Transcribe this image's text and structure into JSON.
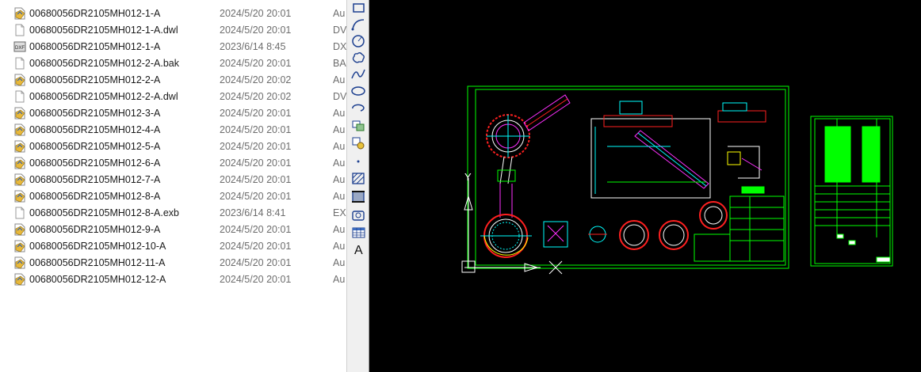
{
  "files": [
    {
      "name": "00680056DR2105MH012-1-A",
      "date": "2024/5/20 20:01",
      "type": "Au",
      "icon": "dwg-icon"
    },
    {
      "name": "00680056DR2105MH012-1-A.dwl",
      "date": "2024/5/20 20:01",
      "type": "DV",
      "icon": "blank-file-icon"
    },
    {
      "name": "00680056DR2105MH012-1-A",
      "date": "2023/6/14 8:45",
      "type": "DX",
      "icon": "dxf-icon"
    },
    {
      "name": "00680056DR2105MH012-2-A.bak",
      "date": "2024/5/20 20:01",
      "type": "BA",
      "icon": "blank-file-icon"
    },
    {
      "name": "00680056DR2105MH012-2-A",
      "date": "2024/5/20 20:02",
      "type": "Au",
      "icon": "dwg-icon"
    },
    {
      "name": "00680056DR2105MH012-2-A.dwl",
      "date": "2024/5/20 20:02",
      "type": "DV",
      "icon": "blank-file-icon"
    },
    {
      "name": "00680056DR2105MH012-3-A",
      "date": "2024/5/20 20:01",
      "type": "Au",
      "icon": "dwg-icon"
    },
    {
      "name": "00680056DR2105MH012-4-A",
      "date": "2024/5/20 20:01",
      "type": "Au",
      "icon": "dwg-icon"
    },
    {
      "name": "00680056DR2105MH012-5-A",
      "date": "2024/5/20 20:01",
      "type": "Au",
      "icon": "dwg-icon"
    },
    {
      "name": "00680056DR2105MH012-6-A",
      "date": "2024/5/20 20:01",
      "type": "Au",
      "icon": "dwg-icon"
    },
    {
      "name": "00680056DR2105MH012-7-A",
      "date": "2024/5/20 20:01",
      "type": "Au",
      "icon": "dwg-icon"
    },
    {
      "name": "00680056DR2105MH012-8-A",
      "date": "2024/5/20 20:01",
      "type": "Au",
      "icon": "dwg-icon"
    },
    {
      "name": "00680056DR2105MH012-8-A.exb",
      "date": "2023/6/14 8:41",
      "type": "EX",
      "icon": "blank-file-icon"
    },
    {
      "name": "00680056DR2105MH012-9-A",
      "date": "2024/5/20 20:01",
      "type": "Au",
      "icon": "dwg-icon"
    },
    {
      "name": "00680056DR2105MH012-10-A",
      "date": "2024/5/20 20:01",
      "type": "Au",
      "icon": "dwg-icon"
    },
    {
      "name": "00680056DR2105MH012-11-A",
      "date": "2024/5/20 20:01",
      "type": "Au",
      "icon": "dwg-icon"
    },
    {
      "name": "00680056DR2105MH012-12-A",
      "date": "2024/5/20 20:01",
      "type": "Au",
      "icon": "dwg-icon"
    }
  ],
  "toolbar": {
    "tools": [
      {
        "name": "rectangle-tool",
        "icon": "rectangle-icon"
      },
      {
        "name": "arc-tool",
        "icon": "arc-icon"
      },
      {
        "name": "circle-tool",
        "icon": "circle-icon"
      },
      {
        "name": "revision-cloud-tool",
        "icon": "cloud-icon"
      },
      {
        "name": "spline-tool",
        "icon": "spline-icon"
      },
      {
        "name": "ellipse-tool",
        "icon": "ellipse-icon"
      },
      {
        "name": "ellipse-arc-tool",
        "icon": "ellipse-arc-icon"
      },
      {
        "name": "insert-block-tool",
        "icon": "insert-block-icon"
      },
      {
        "name": "make-block-tool",
        "icon": "make-block-icon"
      },
      {
        "name": "point-tool",
        "icon": "point-icon"
      },
      {
        "name": "hatch-tool",
        "icon": "hatch-icon"
      },
      {
        "name": "gradient-tool",
        "icon": "gradient-icon"
      },
      {
        "name": "region-tool",
        "icon": "region-icon"
      },
      {
        "name": "table-tool",
        "icon": "table-icon"
      },
      {
        "name": "multiline-text-tool",
        "icon": "text-icon",
        "label": "A"
      }
    ]
  },
  "cad": {
    "background": "#000000",
    "frame_color": "#00ff00",
    "cyan": "#00ffff",
    "red": "#ff2020",
    "magenta": "#ff30ff",
    "white": "#ffffff",
    "yellow": "#ffff00",
    "ucs_labels": {
      "y": "Y",
      "x": "X"
    }
  }
}
